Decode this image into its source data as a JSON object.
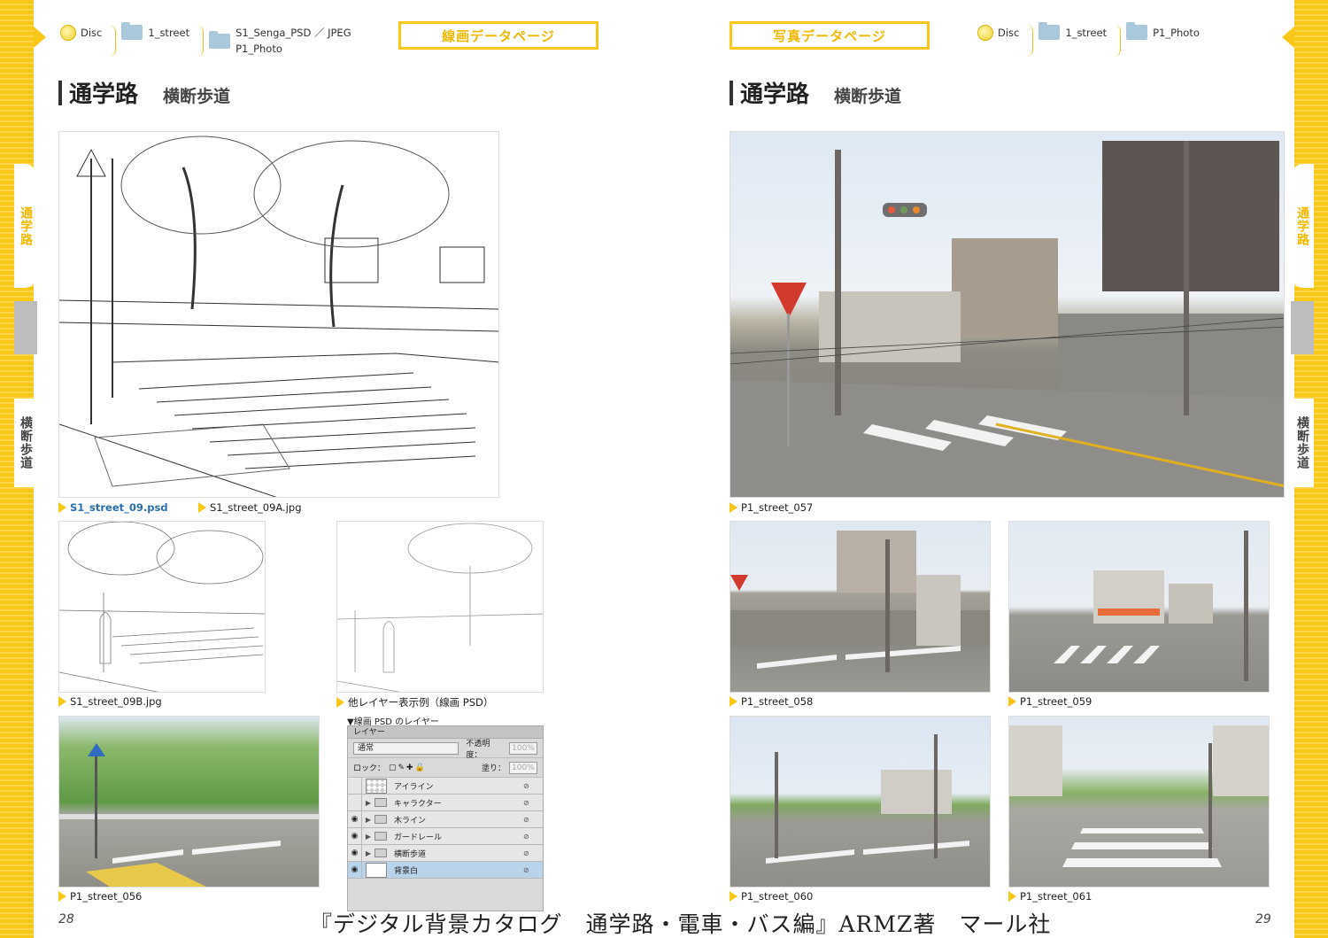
{
  "left_page": {
    "breadcrumb": {
      "disc": "Disc",
      "folder1": "1_street",
      "folder2_line1": "S1_Senga_PSD ／ JPEG",
      "folder2_line2": "P1_Photo"
    },
    "badge": "線画データページ",
    "heading": {
      "title": "通学路",
      "subtitle": "横断歩道"
    },
    "side_tabs": {
      "top": "通学路",
      "bottom": "横断歩道"
    },
    "captions": {
      "main_psd": "S1_street_09.psd",
      "main_jpg": "S1_street_09A.jpg",
      "small_b": "S1_street_09B.jpg",
      "layer_example": "他レイヤー表示例（線画 PSD）",
      "photo_056": "P1_street_056"
    },
    "layer_panel": {
      "title": "▼線画 PSD のレイヤー",
      "header": "レイヤー",
      "blend_mode": "通常",
      "opacity_label": "不透明度：",
      "opacity_value": "100%",
      "lock_label": "ロック：",
      "fill_label": "塗り：",
      "fill_value": "100%",
      "layers": [
        {
          "name": "アイライン",
          "visible": false,
          "type": "layer"
        },
        {
          "name": "キャラクター",
          "visible": false,
          "type": "folder"
        },
        {
          "name": "木ライン",
          "visible": true,
          "type": "folder"
        },
        {
          "name": "ガードレール",
          "visible": true,
          "type": "folder"
        },
        {
          "name": "横断歩道",
          "visible": true,
          "type": "folder"
        },
        {
          "name": "背景白",
          "visible": true,
          "type": "layer",
          "active": true
        }
      ]
    },
    "page_number": "28"
  },
  "right_page": {
    "breadcrumb": {
      "disc": "Disc",
      "folder1": "1_street",
      "folder2": "P1_Photo"
    },
    "badge": "写真データページ",
    "heading": {
      "title": "通学路",
      "subtitle": "横断歩道"
    },
    "side_tabs": {
      "top": "通学路",
      "bottom": "横断歩道"
    },
    "captions": {
      "photo_057": "P1_street_057",
      "photo_058": "P1_street_058",
      "photo_059": "P1_street_059",
      "photo_060": "P1_street_060",
      "photo_061": "P1_street_061"
    },
    "page_number": "29"
  },
  "footer": "『デジタル背景カタログ　通学路・電車・バス編』ARMZ著　マール社",
  "colors": {
    "accent": "#f9c718",
    "caption_blue": "#2a6fb0"
  }
}
